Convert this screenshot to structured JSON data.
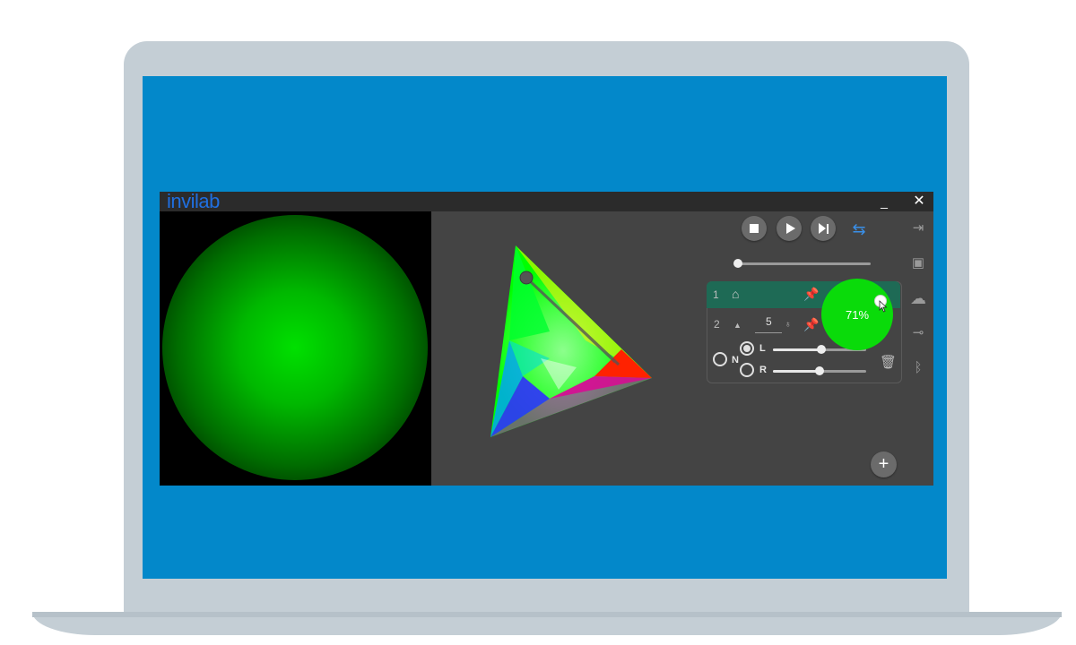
{
  "app": {
    "logo": "invilab",
    "minimize_label": "_",
    "close_label": "✕"
  },
  "colors": {
    "accent": "#1e6a55",
    "preview_light": "#00e000",
    "bubble": "#0adb0a",
    "screen_bg": "#0388ca",
    "loop_icon": "#3a8fe8"
  },
  "transport": {
    "stop_icon": "stop-icon",
    "play_icon": "play-icon",
    "next_icon": "skip-next-icon",
    "loop_icon": "loop-icon",
    "position": 0.0
  },
  "scenes": {
    "row1": {
      "number": "1",
      "icons": [
        "home-icon",
        "pin-icon"
      ]
    },
    "row2": {
      "number": "2",
      "value": "5",
      "icons": [
        "chevron-up-icon",
        "fader-icon",
        "pin-icon",
        "trash-icon"
      ],
      "channels": [
        {
          "label": "L",
          "selected": true,
          "level": 0.52
        },
        {
          "label": "R",
          "selected": false,
          "level": 0.5
        }
      ],
      "group_label": "N"
    }
  },
  "bubble": {
    "value": "71%"
  },
  "sidebar": {
    "icons": [
      "exit-icon",
      "save-icon",
      "cloud-icon",
      "plug-icon",
      "bluetooth-icon"
    ]
  },
  "add_button": {
    "label": "+"
  }
}
